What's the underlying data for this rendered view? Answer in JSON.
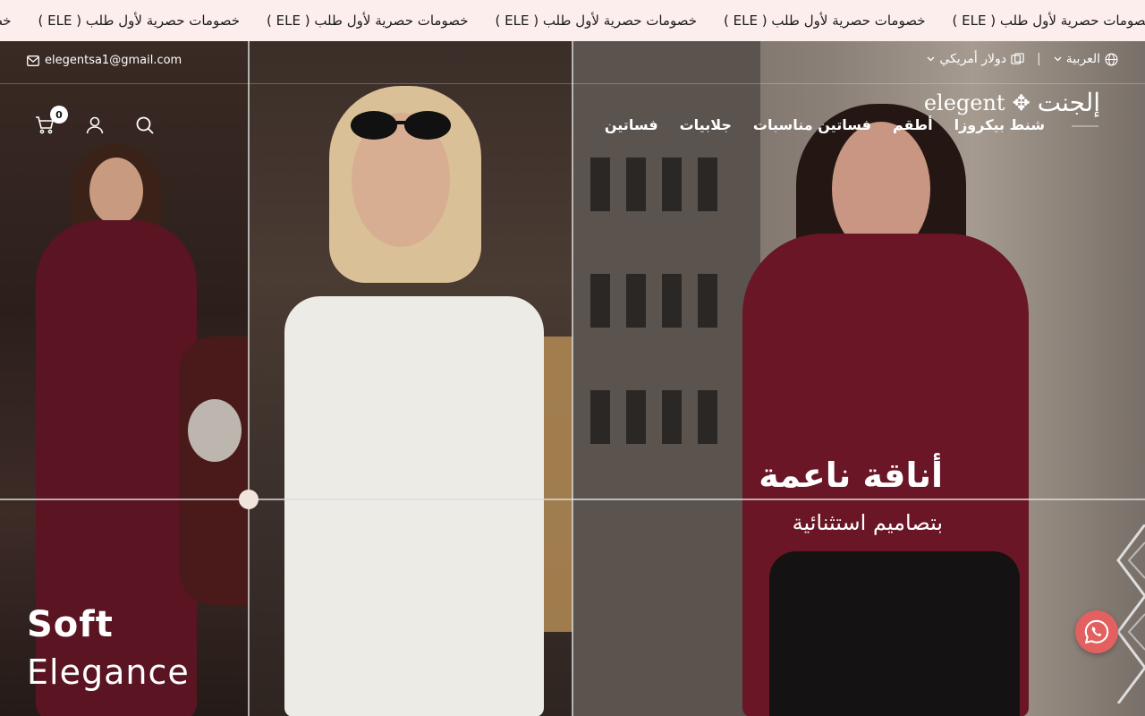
{
  "announcement": {
    "items": [
      "خصومات حصرية لأول طلب ( ELE )",
      "خصومات حصرية لأول طلب ( ELE )",
      "خصومات حصرية لأول طلب ( ELE )",
      "خصومات حصرية لأول طلب ( ELE )",
      "خصومات حصرية لأول طلب ( ELE )",
      "خصومات حصرية لأول طلب ( ELE )"
    ]
  },
  "topbar": {
    "email": "elegentsa1@gmail.com",
    "language": "العربية",
    "currency": "دولار أمريكي",
    "separator": "|"
  },
  "header": {
    "logo_latin": "elegent",
    "logo_arabic": "إلجنت",
    "logo_mark": "✥",
    "nav": [
      "فساتين",
      "جلابيات",
      "فساتين مناسبات",
      "أطقم",
      "شنط بيكروزا"
    ],
    "cart_count": "0"
  },
  "hero": {
    "left_title_bold": "Soft",
    "left_title_light": "Elegance",
    "right_title": "أناقة ناعمة",
    "right_subtitle": "بتصاميم استثنائية"
  },
  "icons": {
    "search": "search-icon",
    "account": "user-icon",
    "cart": "cart-icon",
    "email": "mail-icon",
    "globe": "globe-icon",
    "currency": "money-icon",
    "whatsapp": "whatsapp-icon"
  },
  "colors": {
    "announcement_bg": "#fbeeec",
    "whatsapp_bg": "#e2605f",
    "dress_burgundy": "#6a1626"
  }
}
